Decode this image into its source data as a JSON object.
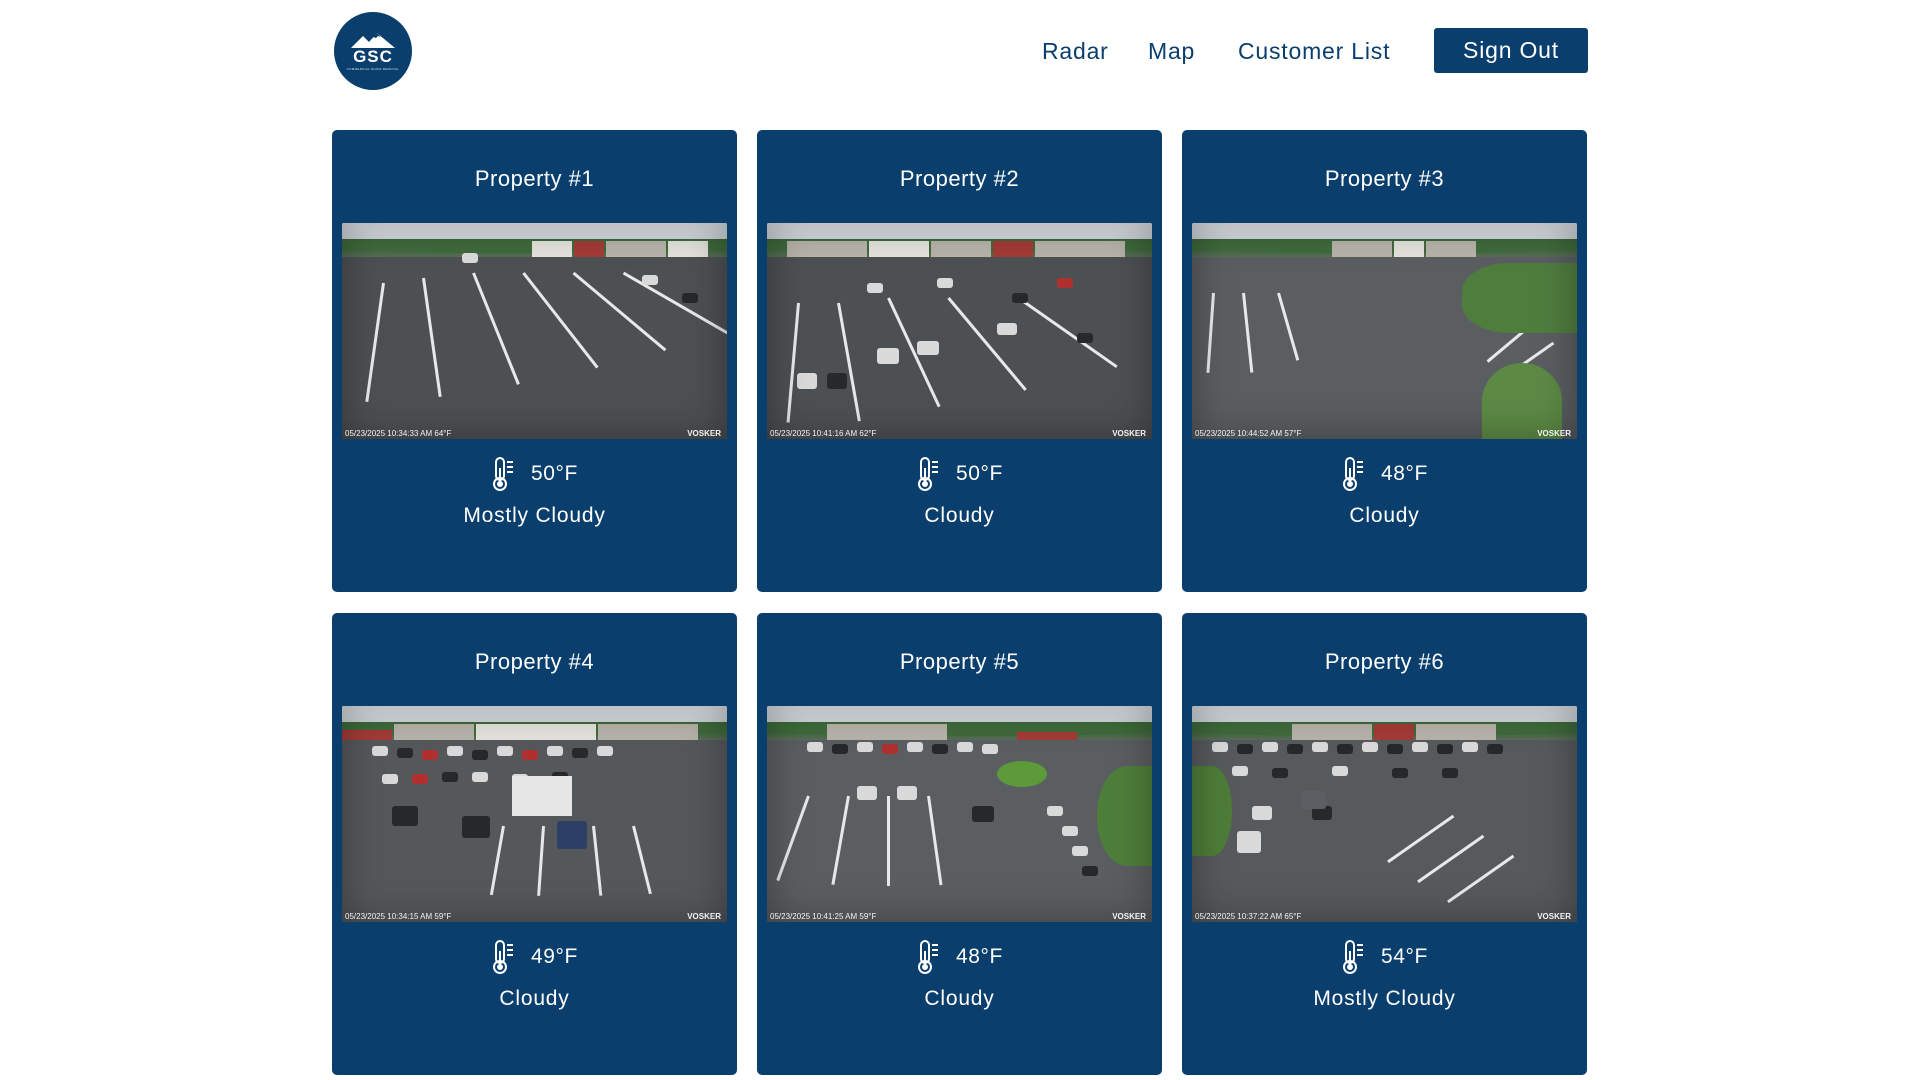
{
  "header": {
    "logo_text": "GSC",
    "logo_subtext": "COMMERCIAL SNOW REMOVAL",
    "nav": {
      "radar": "Radar",
      "map": "Map",
      "customer_list": "Customer List",
      "sign_out": "Sign Out"
    }
  },
  "colors": {
    "primary": "#0a3e6d",
    "background": "#ffffff",
    "text_on_primary": "#ffffff"
  },
  "properties": [
    {
      "name": "Property #1",
      "cam_stamp": "05/23/2025  10:34:33 AM  64°F",
      "cam_brand": "VOSKER",
      "temperature": "50°F",
      "condition": "Mostly Cloudy"
    },
    {
      "name": "Property #2",
      "cam_stamp": "05/23/2025  10:41:16 AM  62°F",
      "cam_brand": "VOSKER",
      "temperature": "50°F",
      "condition": "Cloudy"
    },
    {
      "name": "Property #3",
      "cam_stamp": "05/23/2025  10:44:52 AM  57°F",
      "cam_brand": "VOSKER",
      "temperature": "48°F",
      "condition": "Cloudy"
    },
    {
      "name": "Property #4",
      "cam_stamp": "05/23/2025  10:34:15 AM  59°F",
      "cam_brand": "VOSKER",
      "temperature": "49°F",
      "condition": "Cloudy"
    },
    {
      "name": "Property #5",
      "cam_stamp": "05/23/2025  10:41:25 AM  59°F",
      "cam_brand": "VOSKER",
      "temperature": "48°F",
      "condition": "Cloudy"
    },
    {
      "name": "Property #6",
      "cam_stamp": "05/23/2025  10:37:22 AM  65°F",
      "cam_brand": "VOSKER",
      "temperature": "54°F",
      "condition": "Mostly Cloudy"
    }
  ],
  "icons": {
    "weather": "thermometer-icon",
    "logo": "mountain-icon"
  }
}
